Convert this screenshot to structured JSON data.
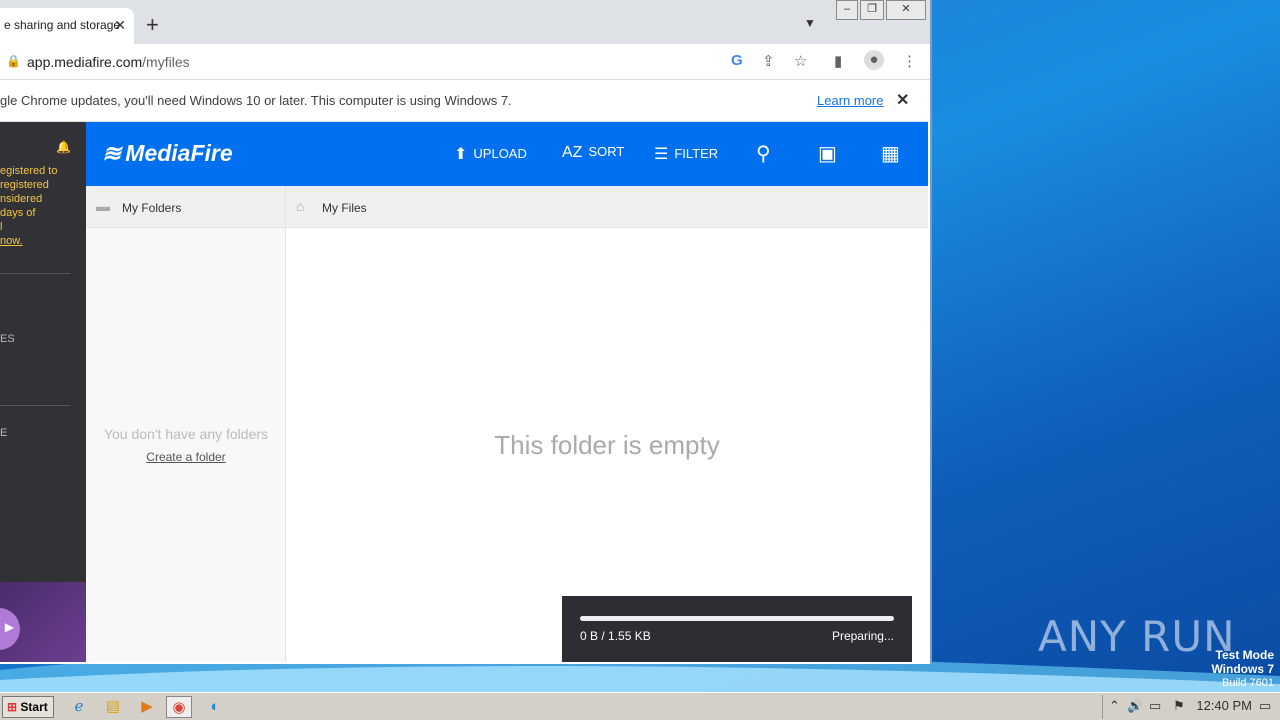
{
  "browser": {
    "tab_title": "e sharing and storage",
    "address_domain": "app.mediafire.com",
    "address_path": "/myfiles",
    "infobar_text": "gle Chrome updates, you'll need Windows 10 or later. This computer is using Windows 7.",
    "infobar_link": "Learn more"
  },
  "sidebar": {
    "notice_text": "egistered to\nregistered\nnsidered\ndays of\nl",
    "notice_link": "now.",
    "nav1": "ES",
    "nav2": "E"
  },
  "mediafire": {
    "logo": "MediaFire",
    "upload": "UPLOAD",
    "sort": "SORT",
    "filter": "FILTER",
    "sort_icon": "AZ"
  },
  "folders_pane": {
    "title": "My Folders",
    "empty_text": "You don't have any folders",
    "create_link": "Create a folder"
  },
  "files_pane": {
    "title": "My Files",
    "empty_text": "This folder is empty"
  },
  "upload_toast": {
    "size_text": "0 B / 1.55 KB",
    "status": "Preparing...",
    "progress": 0
  },
  "desktop": {
    "watermark": "ANY RUN",
    "testmode_line1": "Test Mode",
    "testmode_line2": "Windows 7",
    "testmode_line3": "Build 7601"
  },
  "taskbar": {
    "start": "Start",
    "clock": "12:40 PM"
  },
  "colors": {
    "mediafire_blue": "#0070f0",
    "sidebar_dark": "#313136",
    "notice_yellow": "#f5c542"
  }
}
